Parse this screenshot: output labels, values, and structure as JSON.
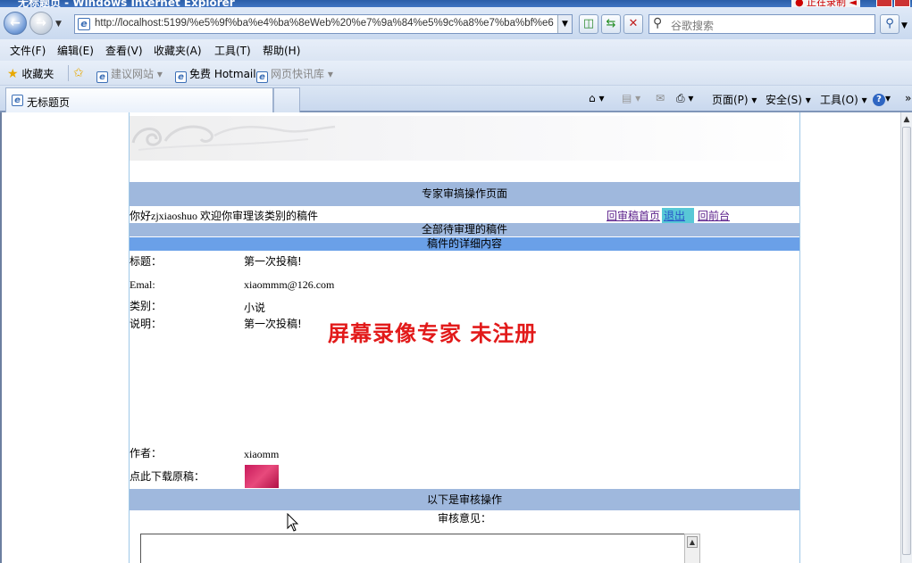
{
  "window": {
    "title": "无标题页 - Windows Internet Explorer",
    "recording_badge": "● 正在录制 ◄"
  },
  "address_bar": {
    "url": "http://localhost:5199/%e5%9f%ba%e4%ba%8eWeb%20%e7%9a%84%e5%9c%a8%e7%ba%bf%e6%",
    "search_placeholder": "谷歌搜索"
  },
  "menu": {
    "items": [
      "文件(F)",
      "编辑(E)",
      "查看(V)",
      "收藏夹(A)",
      "工具(T)",
      "帮助(H)"
    ]
  },
  "favorites_bar": {
    "favorites_label": "收藏夹",
    "suggested_sites": "建议网站 ▾",
    "hotmail": "免费 Hotmail",
    "web_slice": "网页快讯库 ▾"
  },
  "tab": {
    "title": "无标题页"
  },
  "command_bar": {
    "page": "页面(P) ▾",
    "safety": "安全(S) ▾",
    "tools": "工具(O) ▾",
    "help": "▾",
    "more": "»"
  },
  "page": {
    "header_title": "专家审搞操作页面",
    "greeting": "你好zjxiaoshuo 欢迎你审理该类别的稿件",
    "links": {
      "back_home": "回审稿首页",
      "logout": "退出",
      "front": "回前台"
    },
    "all_pending": "全部待审理的稿件",
    "detail_title": "稿件的详细内容",
    "fields": {
      "title_label": "标题：",
      "title_value": "第一次投稿!",
      "email_label": "Emal:",
      "email_value": "xiaommm@126.com",
      "category_label": "类别：",
      "category_value": "小说",
      "desc_label": "说明：",
      "desc_value": "第一次投稿!",
      "author_label": "作者：",
      "author_value": "xiaomm",
      "download_label": "点此下载原稿："
    },
    "ops_title": "以下是审核操作",
    "review_label": "审核意见："
  },
  "watermark": {
    "text": "屏幕录像专家  未注册",
    "color": "#e21a1a"
  },
  "colors": {
    "bar_light": "#9fb8dd",
    "bar_dark": "#6aa0e8",
    "link": "#5a1e8a"
  }
}
